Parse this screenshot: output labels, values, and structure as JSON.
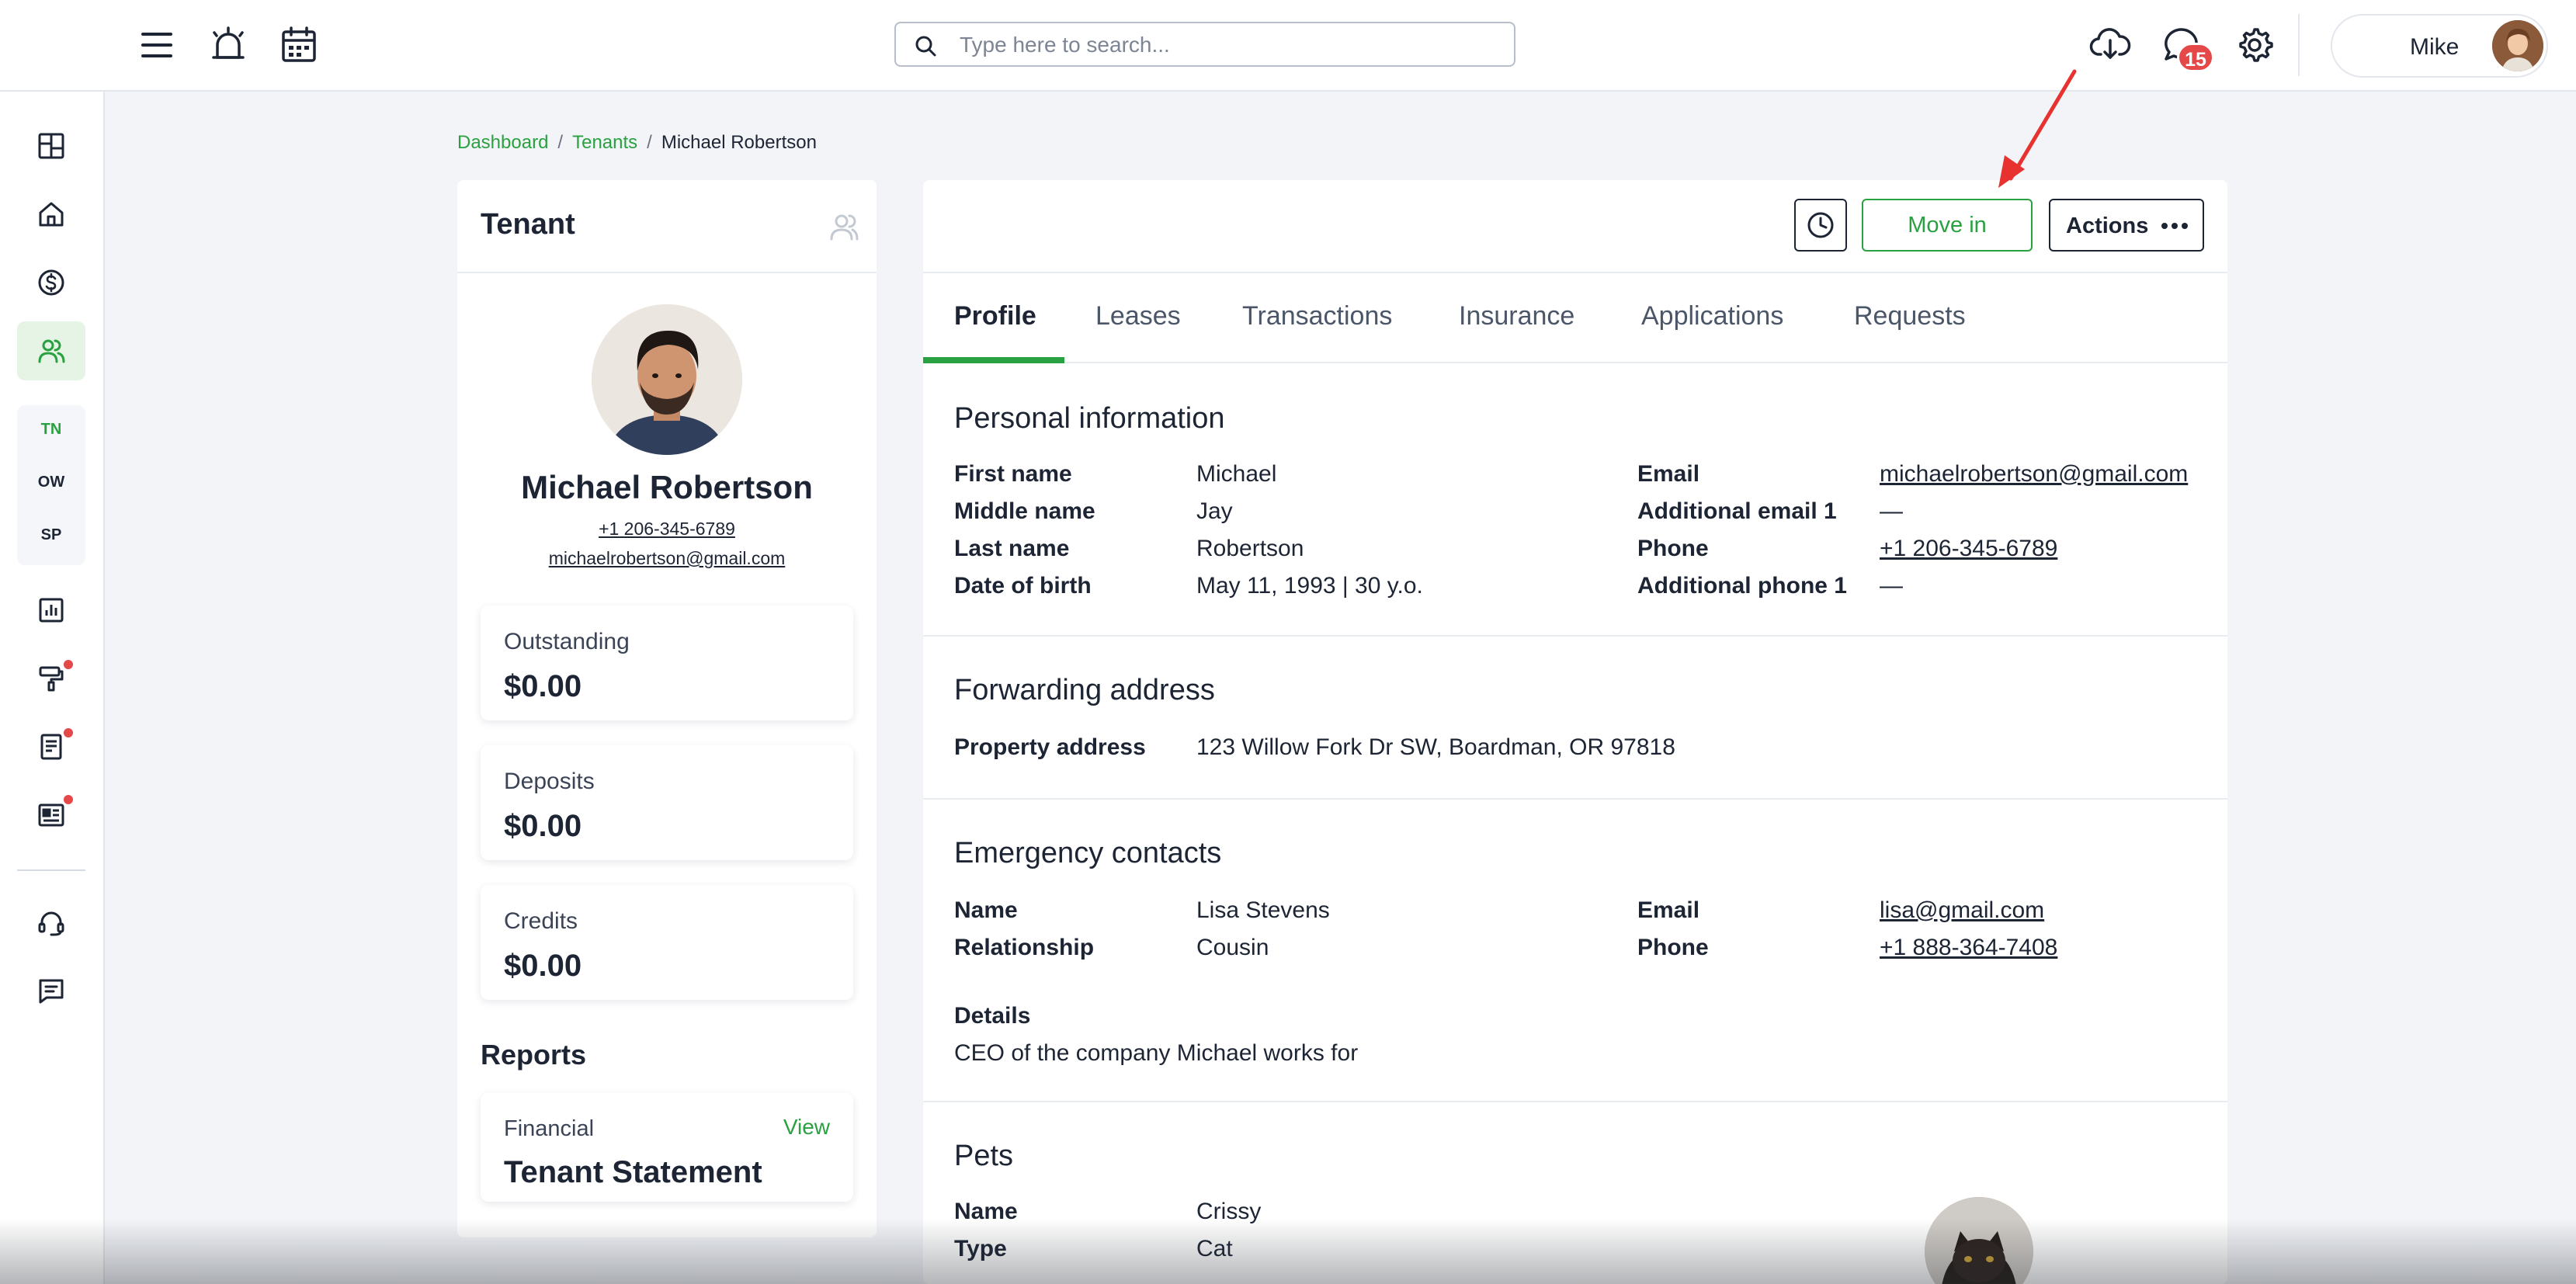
{
  "topbar": {
    "search_placeholder": "Type here to search...",
    "notification_count": "15",
    "user_name": "Mike"
  },
  "nav": {
    "sub_items": [
      "TN",
      "OW",
      "SP"
    ]
  },
  "breadcrumb": {
    "items": [
      "Dashboard",
      "Tenants"
    ],
    "current": "Michael Robertson"
  },
  "tenant_card": {
    "title": "Tenant",
    "name": "Michael Robertson",
    "phone": "+1 206-345-6789",
    "email": "michaelrobertson@gmail.com",
    "stats": [
      {
        "label": "Outstanding",
        "value": "$0.00"
      },
      {
        "label": "Deposits",
        "value": "$0.00"
      },
      {
        "label": "Credits",
        "value": "$0.00"
      }
    ],
    "reports_title": "Reports",
    "report": {
      "category": "Financial",
      "view_label": "View",
      "name": "Tenant Statement"
    }
  },
  "actions": {
    "move_in_label": "Move in",
    "actions_label": "Actions"
  },
  "tabs": [
    "Profile",
    "Leases",
    "Transactions",
    "Insurance",
    "Applications",
    "Requests"
  ],
  "personal": {
    "title": "Personal information",
    "left": [
      {
        "label": "First name",
        "value": "Michael"
      },
      {
        "label": "Middle name",
        "value": "Jay"
      },
      {
        "label": "Last name",
        "value": "Robertson"
      },
      {
        "label": "Date of birth",
        "value": "May 11, 1993 | 30 y.o."
      }
    ],
    "right": [
      {
        "label": "Email",
        "value": "michaelrobertson@gmail.com"
      },
      {
        "label": "Additional email 1",
        "value": "—"
      },
      {
        "label": "Phone",
        "value": "+1 206-345-6789"
      },
      {
        "label": "Additional phone 1",
        "value": "—"
      }
    ]
  },
  "forwarding": {
    "title": "Forwarding address",
    "label": "Property address",
    "value": "123 Willow Fork Dr SW, Boardman, OR 97818"
  },
  "emergency": {
    "title": "Emergency contacts",
    "left": [
      {
        "label": "Name",
        "value": "Lisa Stevens"
      },
      {
        "label": "Relationship",
        "value": "Cousin"
      }
    ],
    "right": [
      {
        "label": "Email",
        "value": "lisa@gmail.com"
      },
      {
        "label": "Phone",
        "value": "+1 888-364-7408"
      }
    ],
    "details_label": "Details",
    "details_value": "CEO of the company Michael works for"
  },
  "pets": {
    "title": "Pets",
    "rows": [
      {
        "label": "Name",
        "value": "Crissy"
      },
      {
        "label": "Type",
        "value": "Cat"
      }
    ]
  },
  "colors": {
    "accent": "#2aa141",
    "badge": "#e44848",
    "text": "#1d2535",
    "background": "#f2f4f8"
  }
}
